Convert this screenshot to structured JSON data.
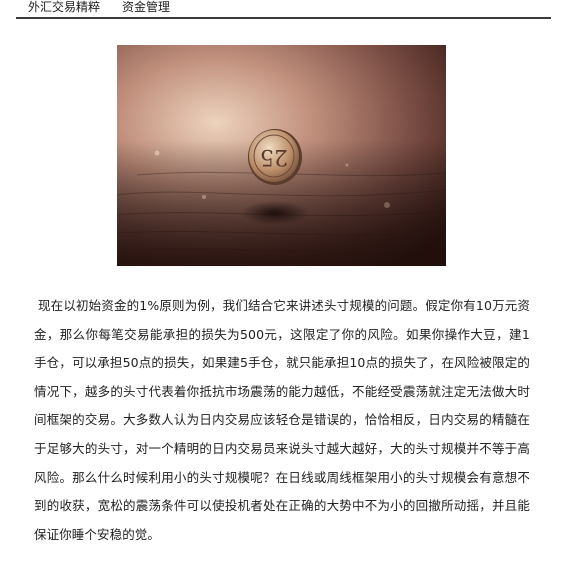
{
  "nav": {
    "tabs": [
      {
        "label": "外汇交易精粹"
      },
      {
        "label": "资金管理"
      }
    ]
  },
  "image": {
    "subject": "coin-standing-on-edge",
    "colors": {
      "dark": "#2a1410",
      "mid": "#8a5a4a",
      "light": "#e9cdb8",
      "coin": "#c9a27a"
    }
  },
  "article": {
    "body": "现在以初始资金的1%原则为例，我们结合它来讲述头寸规模的问题。假定你有10万元资金，那么你每笔交易能承担的损失为500元，这限定了你的风险。如果你操作大豆，建1手仓，可以承担50点的损失，如果建5手仓，就只能承担10点的损失了，在风险被限定的情况下，越多的头寸代表着你抵抗市场震荡的能力越低，不能经受震荡就注定无法做大时间框架的交易。大多数人认为日内交易应该轻仓是错误的，恰恰相反，日内交易的精髓在于足够大的头寸，对一个精明的日内交易员来说头寸越大越好，大的头寸规模并不等于高风险。那么什么时候利用小的头寸规模呢？在日线或周线框架用小的头寸规模会有意想不到的收获，宽松的震荡条件可以使投机者处在正确的大势中不为小的回撤所动摇，并且能保证你睡个安稳的觉。"
  }
}
